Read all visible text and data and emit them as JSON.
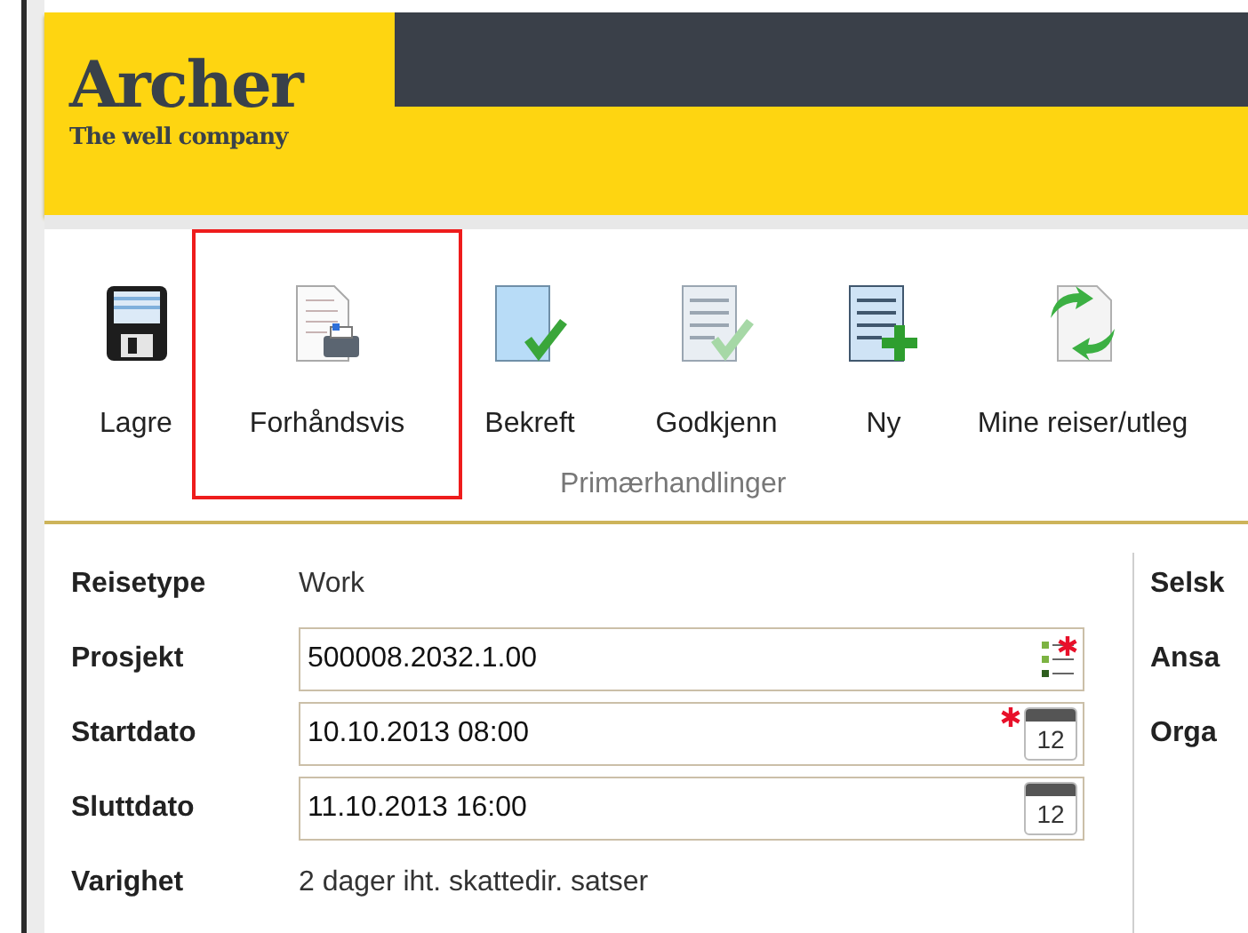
{
  "header": {
    "logo_title": "Archer",
    "logo_tagline": "The well company"
  },
  "toolbar": {
    "items": [
      {
        "label": "Lagre",
        "kind": "save",
        "highlighted": false
      },
      {
        "label": "Forhåndsvis",
        "kind": "preview",
        "highlighted": true
      },
      {
        "label": "Bekreft",
        "kind": "confirm",
        "highlighted": false
      },
      {
        "label": "Godkjenn",
        "kind": "approve",
        "highlighted": false
      },
      {
        "label": "Ny",
        "kind": "new",
        "highlighted": false
      },
      {
        "label": "Mine reiser/utleg",
        "kind": "mine",
        "highlighted": false
      }
    ],
    "group_label": "Primærhandlinger"
  },
  "form": {
    "rows": [
      {
        "label": "Reisetype",
        "kind": "text",
        "value": "Work"
      },
      {
        "label": "Prosjekt",
        "kind": "lookup",
        "value": "500008.2032.1.00",
        "required": true
      },
      {
        "label": "Startdato",
        "kind": "date",
        "value": "10.10.2013 08:00",
        "required": true,
        "calendar_day": "12"
      },
      {
        "label": "Sluttdato",
        "kind": "date",
        "value": "11.10.2013 16:00",
        "required": false,
        "calendar_day": "12"
      },
      {
        "label": "Varighet",
        "kind": "text",
        "value": "2 dager iht. skattedir. satser"
      }
    ],
    "right_labels": [
      "Selsk",
      "Ansa",
      "Orga"
    ]
  }
}
